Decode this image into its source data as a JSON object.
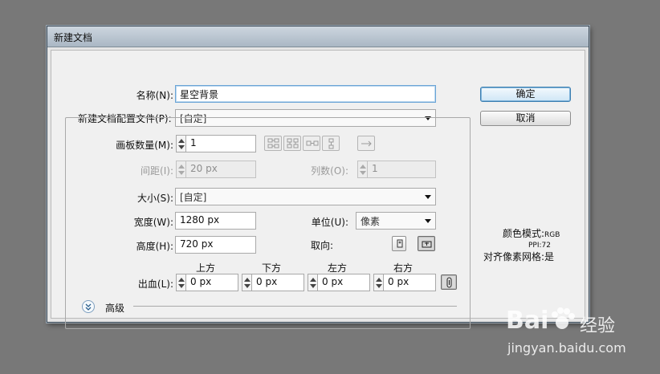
{
  "dialog": {
    "title": "新建文档",
    "name_label": "名称(N):",
    "name_value": "星空背景",
    "profile_label": "新建文档配置文件(P):",
    "profile_value": "[自定]",
    "artboards_label": "画板数量(M):",
    "artboards_value": "1",
    "spacing_label": "间距(I):",
    "spacing_value": "20 px",
    "columns_label": "列数(O):",
    "columns_value": "1",
    "size_label": "大小(S):",
    "size_value": "[自定]",
    "width_label": "宽度(W):",
    "width_value": "1280 px",
    "units_label": "单位(U):",
    "units_value": "像素",
    "height_label": "高度(H):",
    "height_value": "720 px",
    "orientation_label": "取向:",
    "bleed_label": "出血(L):",
    "bleed_headers": [
      "上方",
      "下方",
      "左方",
      "右方"
    ],
    "bleed_values": [
      "0 px",
      "0 px",
      "0 px",
      "0 px"
    ],
    "advanced_label": "高级",
    "ok_label": "确定",
    "cancel_label": "取消",
    "info": {
      "color_mode_label": "颜色模式:",
      "color_mode_value": "RGB",
      "ppi_label": "PPI:",
      "ppi_value": "72",
      "align_label": "对齐像素网格:",
      "align_value": "是"
    }
  },
  "watermark": {
    "brand": "Bai",
    "brand_suffix": "经验",
    "url": "jingyan.baidu.com"
  },
  "colors": {
    "desktop": "#787878",
    "dialog_bg": "#f0f0f0",
    "focus": "#6aa4d6"
  },
  "icons": [
    "grid-by-row-icon",
    "grid-by-column-icon",
    "arrange-by-row-icon",
    "arrange-by-column-icon",
    "right-to-left-icon",
    "portrait-icon",
    "landscape-icon",
    "link-icon",
    "expand-chevron-icon",
    "paw-icon"
  ]
}
